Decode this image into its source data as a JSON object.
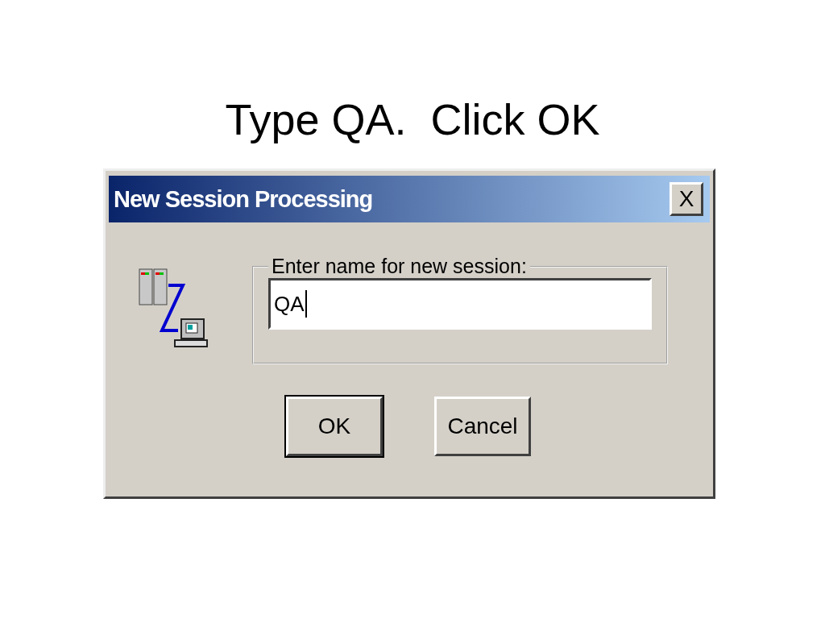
{
  "slide": {
    "title": "Type QA.  Click OK"
  },
  "dialog": {
    "title": "New Session Processing",
    "close_button": "X",
    "group_label": "Enter name for new session:",
    "name_field": {
      "value": "QA",
      "focused": true
    },
    "buttons": [
      {
        "label": "OK",
        "default": true
      },
      {
        "label": "Cancel",
        "default": false
      }
    ]
  }
}
